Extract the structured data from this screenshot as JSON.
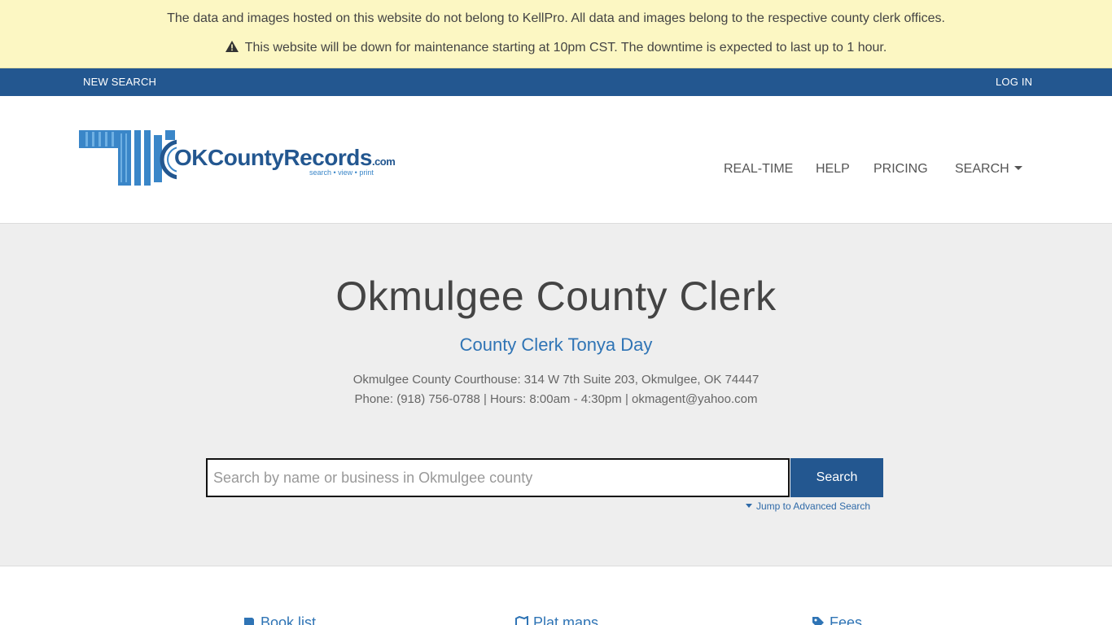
{
  "notice": {
    "line1": "The data and images hosted on this website do not belong to KellPro. All data and images belong to the respective county clerk offices.",
    "line2": "This website will be down for maintenance starting at 10pm CST. The downtime is expected to last up to 1 hour.",
    "icon": "warning-icon"
  },
  "top_nav": {
    "new_search": "NEW SEARCH",
    "log_in": "LOG IN"
  },
  "logo": {
    "brand_ok": "OK",
    "brand_rest": "CountyRecords",
    "brand_tld": ".com",
    "tagline": "search • view • print"
  },
  "main_nav": {
    "realtime": "REAL-TIME",
    "help": "HELP",
    "pricing": "PRICING",
    "search": "SEARCH"
  },
  "hero": {
    "title": "Okmulgee County Clerk",
    "subtitle": "County Clerk Tonya Day",
    "address": "Okmulgee County Courthouse: 314 W 7th Suite 203, Okmulgee, OK 74447",
    "contact": "Phone: (918) 756-0788 | Hours: 8:00am - 4:30pm | okmagent@yahoo.com"
  },
  "search": {
    "placeholder": "Search by name or business in Okmulgee county",
    "value": "",
    "button_label": "Search",
    "advanced_link": "Jump to Advanced Search"
  },
  "bottom_links": {
    "book_list": "Book list",
    "plat_maps": "Plat maps",
    "fees": "Fees"
  },
  "colors": {
    "notice_bg": "#fcf7c3",
    "nav_bg": "#235790",
    "accent": "#2f74b5",
    "hero_bg": "#eeeeee"
  }
}
